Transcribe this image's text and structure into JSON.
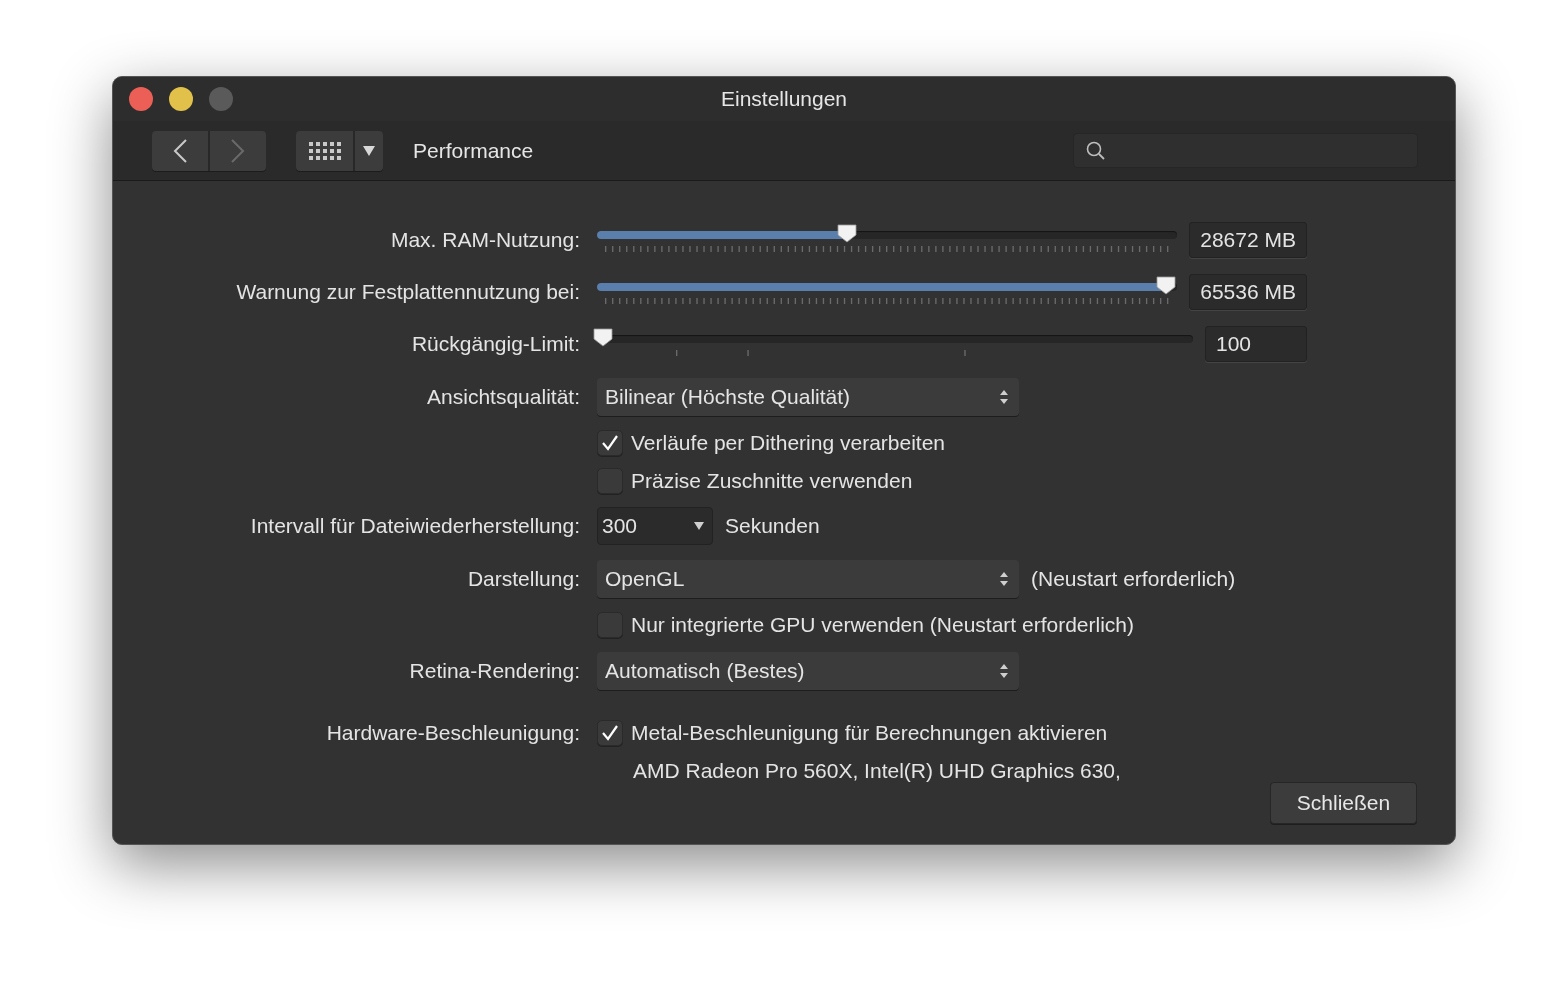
{
  "window": {
    "title": "Einstellungen"
  },
  "toolbar": {
    "section": "Performance"
  },
  "rows": [
    {
      "kind": "slider",
      "label": "Max. RAM-Nutzung:",
      "level": 0.43,
      "value": "28672 MB"
    },
    {
      "kind": "slider",
      "label": "Warnung zur Festplattennutzung bei:",
      "level": 0.98,
      "value": "65536 MB"
    },
    {
      "kind": "stepslider",
      "label": "Rückgängig-Limit:",
      "level": 0.01,
      "value": "100"
    },
    {
      "kind": "popup",
      "label": "Ansichtsqualität:",
      "value": "Bilinear (Höchste Qualität)"
    },
    {
      "kind": "checkbox",
      "text": "Verläufe per Dithering verarbeiten",
      "checked": true
    },
    {
      "kind": "checkbox",
      "text": "Präzise Zuschnitte verwenden",
      "checked": false
    },
    {
      "kind": "combo",
      "label": "Intervall für Dateiwiederherstellung:",
      "value": "300",
      "unit": "Sekunden"
    },
    {
      "kind": "popup",
      "label": "Darstellung:",
      "value": "OpenGL",
      "note": "(Neustart erforderlich)"
    },
    {
      "kind": "checkbox",
      "text": "Nur integrierte GPU verwenden (Neustart erforderlich)",
      "checked": false
    },
    {
      "kind": "popup",
      "label": "Retina-Rendering:",
      "value": "Automatisch (Bestes)"
    },
    {
      "kind": "checkbox",
      "label": "Hardware-Beschleunigung:",
      "text": "Metal-Beschleunigung für Berechnungen aktivieren",
      "checked": true
    },
    {
      "kind": "info",
      "text": "AMD Radeon Pro 560X, Intel(R) UHD Graphics 630,"
    }
  ],
  "close_button": "Schließen"
}
